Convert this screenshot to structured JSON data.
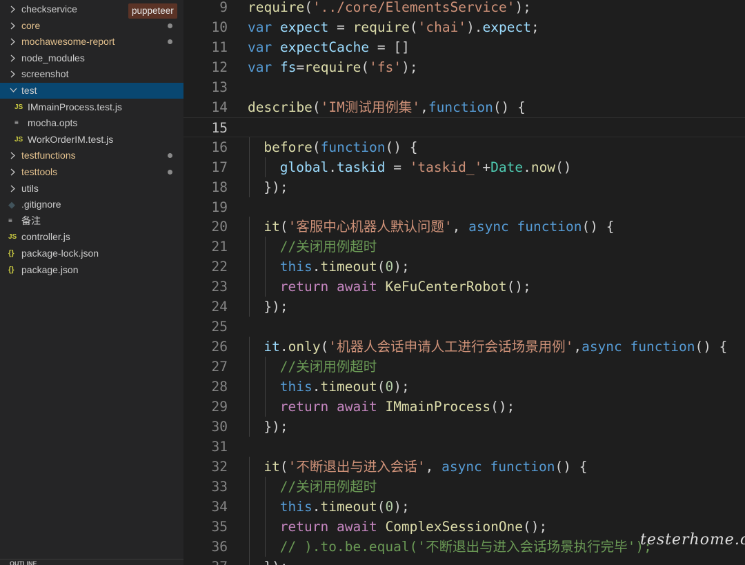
{
  "explorer": {
    "items": [
      {
        "label": "checkservice",
        "kind": "folder",
        "expanded": false,
        "modified": false
      },
      {
        "label": "core",
        "kind": "folder",
        "expanded": false,
        "modified": true
      },
      {
        "label": "mochawesome-report",
        "kind": "folder",
        "expanded": false,
        "modified": true
      },
      {
        "label": "node_modules",
        "kind": "folder",
        "expanded": false,
        "modified": false
      },
      {
        "label": "screenshot",
        "kind": "folder",
        "expanded": false,
        "modified": false
      },
      {
        "label": "test",
        "kind": "folder",
        "expanded": true,
        "modified": false,
        "selected": true
      },
      {
        "label": "IMmainProcess.test.js",
        "kind": "js",
        "icon": "JS"
      },
      {
        "label": "mocha.opts",
        "kind": "text",
        "icon": "≡"
      },
      {
        "label": "WorkOrderIM.test.js",
        "kind": "js",
        "icon": "JS"
      },
      {
        "label": "testfunctions",
        "kind": "folder",
        "expanded": false,
        "modified": true
      },
      {
        "label": "testtools",
        "kind": "folder",
        "expanded": false,
        "modified": true
      },
      {
        "label": "utils",
        "kind": "folder",
        "expanded": false,
        "modified": false
      },
      {
        "label": ".gitignore",
        "kind": "git",
        "icon": "◆"
      },
      {
        "label": "备注",
        "kind": "text",
        "icon": "≡"
      },
      {
        "label": "controller.js",
        "kind": "js",
        "icon": "JS"
      },
      {
        "label": "package-lock.json",
        "kind": "json",
        "icon": "{}"
      },
      {
        "label": "package.json",
        "kind": "json",
        "icon": "{}"
      }
    ],
    "tooltip": "puppeteer",
    "outline_label": "OUTLINE"
  },
  "editor": {
    "current_line": 15,
    "lines": [
      {
        "n": "9",
        "indent": 0,
        "tokens": [
          [
            "fn",
            "require"
          ],
          [
            "pun",
            "("
          ],
          [
            "str",
            "'../core/ElementsService'"
          ],
          [
            "pun",
            ");"
          ]
        ]
      },
      {
        "n": "10",
        "indent": 0,
        "tokens": [
          [
            "kw",
            "var"
          ],
          [
            "pun",
            " "
          ],
          [
            "var",
            "expect"
          ],
          [
            "pun",
            " = "
          ],
          [
            "fn",
            "require"
          ],
          [
            "pun",
            "("
          ],
          [
            "str",
            "'chai'"
          ],
          [
            "pun",
            ")."
          ],
          [
            "var",
            "expect"
          ],
          [
            "pun",
            ";"
          ]
        ]
      },
      {
        "n": "11",
        "indent": 0,
        "tokens": [
          [
            "kw",
            "var"
          ],
          [
            "pun",
            " "
          ],
          [
            "var",
            "expectCache"
          ],
          [
            "pun",
            " = []"
          ]
        ]
      },
      {
        "n": "12",
        "indent": 0,
        "tokens": [
          [
            "kw",
            "var"
          ],
          [
            "pun",
            " "
          ],
          [
            "var",
            "fs"
          ],
          [
            "pun",
            "="
          ],
          [
            "fn",
            "require"
          ],
          [
            "pun",
            "("
          ],
          [
            "str",
            "'fs'"
          ],
          [
            "pun",
            ");"
          ]
        ]
      },
      {
        "n": "13",
        "indent": 0,
        "tokens": []
      },
      {
        "n": "14",
        "indent": 0,
        "tokens": [
          [
            "fn",
            "describe"
          ],
          [
            "pun",
            "("
          ],
          [
            "str",
            "'IM测试用例集'"
          ],
          [
            "pun",
            ","
          ],
          [
            "kw",
            "function"
          ],
          [
            "pun",
            "() {"
          ]
        ]
      },
      {
        "n": "15",
        "indent": 0,
        "tokens": []
      },
      {
        "n": "16",
        "indent": 1,
        "tokens": [
          [
            "fn",
            "before"
          ],
          [
            "pun",
            "("
          ],
          [
            "kw",
            "function"
          ],
          [
            "pun",
            "() {"
          ]
        ]
      },
      {
        "n": "17",
        "indent": 2,
        "tokens": [
          [
            "var",
            "global"
          ],
          [
            "pun",
            "."
          ],
          [
            "var",
            "taskid"
          ],
          [
            "pun",
            " = "
          ],
          [
            "str",
            "'taskid_'"
          ],
          [
            "pun",
            "+"
          ],
          [
            "cls",
            "Date"
          ],
          [
            "pun",
            "."
          ],
          [
            "fn",
            "now"
          ],
          [
            "pun",
            "()"
          ]
        ]
      },
      {
        "n": "18",
        "indent": 1,
        "tokens": [
          [
            "pun",
            "});"
          ]
        ]
      },
      {
        "n": "19",
        "indent": 0,
        "tokens": []
      },
      {
        "n": "20",
        "indent": 1,
        "tokens": [
          [
            "fn",
            "it"
          ],
          [
            "pun",
            "("
          ],
          [
            "str",
            "'客服中心机器人默认问题'"
          ],
          [
            "pun",
            ", "
          ],
          [
            "kw",
            "async"
          ],
          [
            "pun",
            " "
          ],
          [
            "kw",
            "function"
          ],
          [
            "pun",
            "() {"
          ]
        ]
      },
      {
        "n": "21",
        "indent": 2,
        "tokens": [
          [
            "cmt",
            "//关闭用例超时"
          ]
        ]
      },
      {
        "n": "22",
        "indent": 2,
        "tokens": [
          [
            "kw",
            "this"
          ],
          [
            "pun",
            "."
          ],
          [
            "fn",
            "timeout"
          ],
          [
            "pun",
            "("
          ],
          [
            "num",
            "0"
          ],
          [
            "pun",
            ");"
          ]
        ]
      },
      {
        "n": "23",
        "indent": 2,
        "tokens": [
          [
            "ctl",
            "return"
          ],
          [
            "pun",
            " "
          ],
          [
            "ctl",
            "await"
          ],
          [
            "pun",
            " "
          ],
          [
            "fn",
            "KeFuCenterRobot"
          ],
          [
            "pun",
            "();"
          ]
        ]
      },
      {
        "n": "24",
        "indent": 1,
        "tokens": [
          [
            "pun",
            "});"
          ]
        ]
      },
      {
        "n": "25",
        "indent": 0,
        "tokens": []
      },
      {
        "n": "26",
        "indent": 1,
        "tokens": [
          [
            "var",
            "it"
          ],
          [
            "pun",
            "."
          ],
          [
            "fn",
            "only"
          ],
          [
            "pun",
            "("
          ],
          [
            "str",
            "'机器人会话申请人工进行会话场景用例'"
          ],
          [
            "pun",
            ","
          ],
          [
            "kw",
            "async"
          ],
          [
            "pun",
            " "
          ],
          [
            "kw",
            "function"
          ],
          [
            "pun",
            "() {"
          ]
        ]
      },
      {
        "n": "27",
        "indent": 2,
        "tokens": [
          [
            "cmt",
            "//关闭用例超时"
          ]
        ]
      },
      {
        "n": "28",
        "indent": 2,
        "tokens": [
          [
            "kw",
            "this"
          ],
          [
            "pun",
            "."
          ],
          [
            "fn",
            "timeout"
          ],
          [
            "pun",
            "("
          ],
          [
            "num",
            "0"
          ],
          [
            "pun",
            ");"
          ]
        ]
      },
      {
        "n": "29",
        "indent": 2,
        "tokens": [
          [
            "ctl",
            "return"
          ],
          [
            "pun",
            " "
          ],
          [
            "ctl",
            "await"
          ],
          [
            "pun",
            " "
          ],
          [
            "fn",
            "IMmainProcess"
          ],
          [
            "pun",
            "();"
          ]
        ]
      },
      {
        "n": "30",
        "indent": 1,
        "tokens": [
          [
            "pun",
            "});"
          ]
        ]
      },
      {
        "n": "31",
        "indent": 0,
        "tokens": []
      },
      {
        "n": "32",
        "indent": 1,
        "tokens": [
          [
            "fn",
            "it"
          ],
          [
            "pun",
            "("
          ],
          [
            "str",
            "'不断退出与进入会话'"
          ],
          [
            "pun",
            ", "
          ],
          [
            "kw",
            "async"
          ],
          [
            "pun",
            " "
          ],
          [
            "kw",
            "function"
          ],
          [
            "pun",
            "() {"
          ]
        ]
      },
      {
        "n": "33",
        "indent": 2,
        "tokens": [
          [
            "cmt",
            "//关闭用例超时"
          ]
        ]
      },
      {
        "n": "34",
        "indent": 2,
        "tokens": [
          [
            "kw",
            "this"
          ],
          [
            "pun",
            "."
          ],
          [
            "fn",
            "timeout"
          ],
          [
            "pun",
            "("
          ],
          [
            "num",
            "0"
          ],
          [
            "pun",
            ");"
          ]
        ]
      },
      {
        "n": "35",
        "indent": 2,
        "tokens": [
          [
            "ctl",
            "return"
          ],
          [
            "pun",
            " "
          ],
          [
            "ctl",
            "await"
          ],
          [
            "pun",
            " "
          ],
          [
            "fn",
            "ComplexSessionOne"
          ],
          [
            "pun",
            "();"
          ]
        ]
      },
      {
        "n": "36",
        "indent": 2,
        "tokens": [
          [
            "cmt",
            "// ).to.be.equal('不断退出与进入会话场景执行完毕');"
          ]
        ]
      },
      {
        "n": "37",
        "indent": 1,
        "tokens": [
          [
            "pun",
            "});"
          ]
        ]
      }
    ]
  },
  "watermark": "testerhome.com"
}
